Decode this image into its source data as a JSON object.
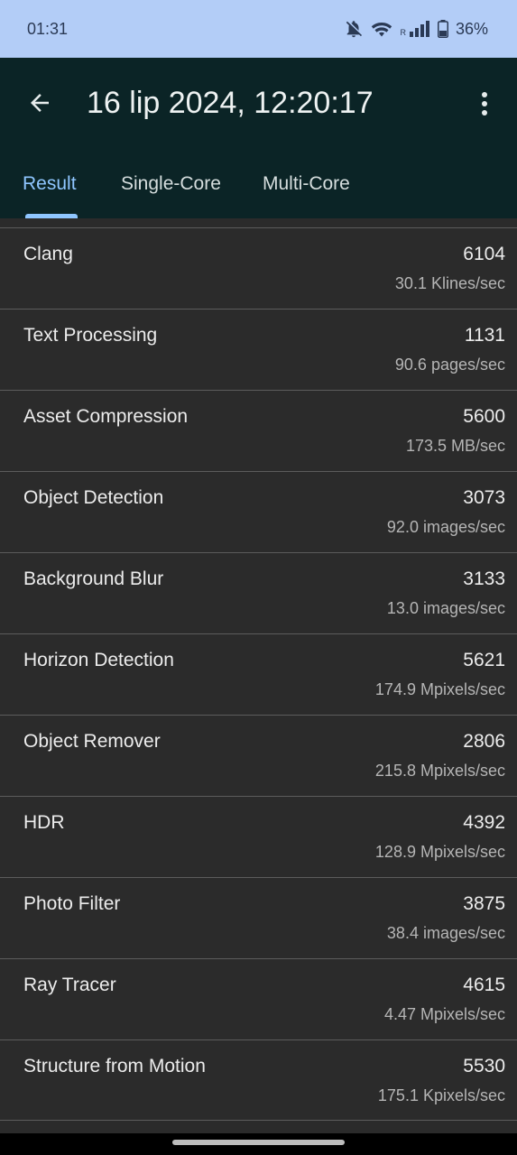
{
  "status_bar": {
    "time": "01:31",
    "icons": [
      "bell-off-icon",
      "wifi-icon",
      "roaming-signal-icon",
      "battery-icon"
    ],
    "roaming_label": "R",
    "battery": "36%"
  },
  "app_bar": {
    "title": "16 lip 2024, 12:20:17",
    "back_icon": "arrow-left-icon",
    "menu_icon": "more-vert-icon",
    "tabs": [
      "Result",
      "Single-Core",
      "Multi-Core"
    ],
    "active_tab": "Result"
  },
  "results": [
    {
      "name": "Clang",
      "score": "6104",
      "rate": "30.1 Klines/sec"
    },
    {
      "name": "Text Processing",
      "score": "1131",
      "rate": "90.6 pages/sec"
    },
    {
      "name": "Asset Compression",
      "score": "5600",
      "rate": "173.5 MB/sec"
    },
    {
      "name": "Object Detection",
      "score": "3073",
      "rate": "92.0 images/sec"
    },
    {
      "name": "Background Blur",
      "score": "3133",
      "rate": "13.0 images/sec"
    },
    {
      "name": "Horizon Detection",
      "score": "5621",
      "rate": "174.9 Mpixels/sec"
    },
    {
      "name": "Object Remover",
      "score": "2806",
      "rate": "215.8 Mpixels/sec"
    },
    {
      "name": "HDR",
      "score": "4392",
      "rate": "128.9 Mpixels/sec"
    },
    {
      "name": "Photo Filter",
      "score": "3875",
      "rate": "38.4 images/sec"
    },
    {
      "name": "Ray Tracer",
      "score": "4615",
      "rate": "4.47 Mpixels/sec"
    },
    {
      "name": "Structure from Motion",
      "score": "5530",
      "rate": "175.1 Kpixels/sec"
    }
  ],
  "colors": {
    "status_bar_bg": "#b3cdf7",
    "app_bar_bg": "#0b2426",
    "accent": "#8fc6ff",
    "list_bg": "#2b2b2b"
  }
}
